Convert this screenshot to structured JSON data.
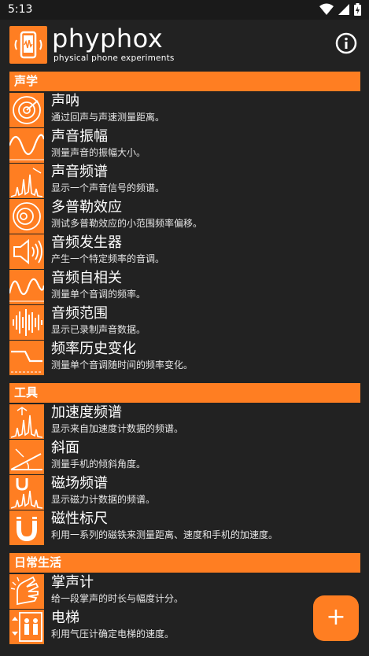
{
  "status": {
    "time": "5:13"
  },
  "app": {
    "title": "phyphox",
    "subtitle": "physical phone experiments"
  },
  "colors": {
    "accent": "#ff7e22",
    "background": "#222222"
  },
  "sections": [
    {
      "label": "声学",
      "items": [
        {
          "title": "声呐",
          "desc": "通过回声与声速测量距离。",
          "icon": "sonar-icon"
        },
        {
          "title": "声音振幅",
          "desc": "测量声音的振幅大小。",
          "icon": "sine-wave-icon"
        },
        {
          "title": "声音频谱",
          "desc": "显示一个声音信号的频谱。",
          "icon": "spectrum-icon"
        },
        {
          "title": "多普勒效应",
          "desc": "测试多普勒效应的小范围频率偏移。",
          "icon": "doppler-icon"
        },
        {
          "title": "音频发生器",
          "desc": "产生一个特定频率的音调。",
          "icon": "speaker-icon"
        },
        {
          "title": "音频自相关",
          "desc": "测量单个音调的频率。",
          "icon": "autocorrelation-icon"
        },
        {
          "title": "音频范围",
          "desc": "显示已录制声音数据。",
          "icon": "waveform-icon"
        },
        {
          "title": "频率历史变化",
          "desc": "测量单个音调随时间的频率变化。",
          "icon": "step-icon"
        }
      ]
    },
    {
      "label": "工具",
      "items": [
        {
          "title": "加速度频谱",
          "desc": "显示来自加速度计数据的频谱。",
          "icon": "accel-spectrum-icon"
        },
        {
          "title": "斜面",
          "desc": "测量手机的倾斜角度。",
          "icon": "incline-icon"
        },
        {
          "title": "磁场频谱",
          "desc": "显示磁力计数据的频谱。",
          "icon": "magnetic-spectrum-icon"
        },
        {
          "title": "磁性标尺",
          "desc": "利用一系列的磁铁来测量距离、速度和手机的加速度。",
          "icon": "magnet-icon"
        }
      ]
    },
    {
      "label": "日常生活",
      "items": [
        {
          "title": "掌声计",
          "desc": "给一段掌声的时长与幅度计分。",
          "icon": "clap-icon"
        },
        {
          "title": "电梯",
          "desc": "利用气压计确定电梯的速度。",
          "icon": "elevator-icon"
        }
      ]
    }
  ],
  "fab": {
    "label": "+"
  }
}
